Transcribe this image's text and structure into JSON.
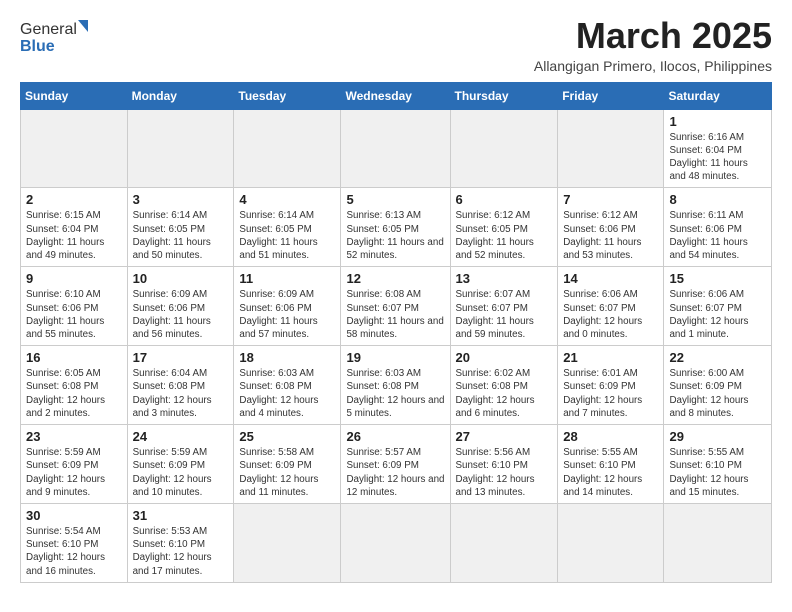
{
  "header": {
    "logo_general": "General",
    "logo_blue": "Blue",
    "month_title": "March 2025",
    "subtitle": "Allangigan Primero, Ilocos, Philippines"
  },
  "weekdays": [
    "Sunday",
    "Monday",
    "Tuesday",
    "Wednesday",
    "Thursday",
    "Friday",
    "Saturday"
  ],
  "weeks": [
    [
      {
        "day": "",
        "info": ""
      },
      {
        "day": "",
        "info": ""
      },
      {
        "day": "",
        "info": ""
      },
      {
        "day": "",
        "info": ""
      },
      {
        "day": "",
        "info": ""
      },
      {
        "day": "",
        "info": ""
      },
      {
        "day": "1",
        "info": "Sunrise: 6:16 AM\nSunset: 6:04 PM\nDaylight: 11 hours and 48 minutes."
      }
    ],
    [
      {
        "day": "2",
        "info": "Sunrise: 6:15 AM\nSunset: 6:04 PM\nDaylight: 11 hours and 49 minutes."
      },
      {
        "day": "3",
        "info": "Sunrise: 6:14 AM\nSunset: 6:05 PM\nDaylight: 11 hours and 50 minutes."
      },
      {
        "day": "4",
        "info": "Sunrise: 6:14 AM\nSunset: 6:05 PM\nDaylight: 11 hours and 51 minutes."
      },
      {
        "day": "5",
        "info": "Sunrise: 6:13 AM\nSunset: 6:05 PM\nDaylight: 11 hours and 52 minutes."
      },
      {
        "day": "6",
        "info": "Sunrise: 6:12 AM\nSunset: 6:05 PM\nDaylight: 11 hours and 52 minutes."
      },
      {
        "day": "7",
        "info": "Sunrise: 6:12 AM\nSunset: 6:06 PM\nDaylight: 11 hours and 53 minutes."
      },
      {
        "day": "8",
        "info": "Sunrise: 6:11 AM\nSunset: 6:06 PM\nDaylight: 11 hours and 54 minutes."
      }
    ],
    [
      {
        "day": "9",
        "info": "Sunrise: 6:10 AM\nSunset: 6:06 PM\nDaylight: 11 hours and 55 minutes."
      },
      {
        "day": "10",
        "info": "Sunrise: 6:09 AM\nSunset: 6:06 PM\nDaylight: 11 hours and 56 minutes."
      },
      {
        "day": "11",
        "info": "Sunrise: 6:09 AM\nSunset: 6:06 PM\nDaylight: 11 hours and 57 minutes."
      },
      {
        "day": "12",
        "info": "Sunrise: 6:08 AM\nSunset: 6:07 PM\nDaylight: 11 hours and 58 minutes."
      },
      {
        "day": "13",
        "info": "Sunrise: 6:07 AM\nSunset: 6:07 PM\nDaylight: 11 hours and 59 minutes."
      },
      {
        "day": "14",
        "info": "Sunrise: 6:06 AM\nSunset: 6:07 PM\nDaylight: 12 hours and 0 minutes."
      },
      {
        "day": "15",
        "info": "Sunrise: 6:06 AM\nSunset: 6:07 PM\nDaylight: 12 hours and 1 minute."
      }
    ],
    [
      {
        "day": "16",
        "info": "Sunrise: 6:05 AM\nSunset: 6:08 PM\nDaylight: 12 hours and 2 minutes."
      },
      {
        "day": "17",
        "info": "Sunrise: 6:04 AM\nSunset: 6:08 PM\nDaylight: 12 hours and 3 minutes."
      },
      {
        "day": "18",
        "info": "Sunrise: 6:03 AM\nSunset: 6:08 PM\nDaylight: 12 hours and 4 minutes."
      },
      {
        "day": "19",
        "info": "Sunrise: 6:03 AM\nSunset: 6:08 PM\nDaylight: 12 hours and 5 minutes."
      },
      {
        "day": "20",
        "info": "Sunrise: 6:02 AM\nSunset: 6:08 PM\nDaylight: 12 hours and 6 minutes."
      },
      {
        "day": "21",
        "info": "Sunrise: 6:01 AM\nSunset: 6:09 PM\nDaylight: 12 hours and 7 minutes."
      },
      {
        "day": "22",
        "info": "Sunrise: 6:00 AM\nSunset: 6:09 PM\nDaylight: 12 hours and 8 minutes."
      }
    ],
    [
      {
        "day": "23",
        "info": "Sunrise: 5:59 AM\nSunset: 6:09 PM\nDaylight: 12 hours and 9 minutes."
      },
      {
        "day": "24",
        "info": "Sunrise: 5:59 AM\nSunset: 6:09 PM\nDaylight: 12 hours and 10 minutes."
      },
      {
        "day": "25",
        "info": "Sunrise: 5:58 AM\nSunset: 6:09 PM\nDaylight: 12 hours and 11 minutes."
      },
      {
        "day": "26",
        "info": "Sunrise: 5:57 AM\nSunset: 6:09 PM\nDaylight: 12 hours and 12 minutes."
      },
      {
        "day": "27",
        "info": "Sunrise: 5:56 AM\nSunset: 6:10 PM\nDaylight: 12 hours and 13 minutes."
      },
      {
        "day": "28",
        "info": "Sunrise: 5:55 AM\nSunset: 6:10 PM\nDaylight: 12 hours and 14 minutes."
      },
      {
        "day": "29",
        "info": "Sunrise: 5:55 AM\nSunset: 6:10 PM\nDaylight: 12 hours and 15 minutes."
      }
    ],
    [
      {
        "day": "30",
        "info": "Sunrise: 5:54 AM\nSunset: 6:10 PM\nDaylight: 12 hours and 16 minutes."
      },
      {
        "day": "31",
        "info": "Sunrise: 5:53 AM\nSunset: 6:10 PM\nDaylight: 12 hours and 17 minutes."
      },
      {
        "day": "",
        "info": ""
      },
      {
        "day": "",
        "info": ""
      },
      {
        "day": "",
        "info": ""
      },
      {
        "day": "",
        "info": ""
      },
      {
        "day": "",
        "info": ""
      }
    ]
  ]
}
